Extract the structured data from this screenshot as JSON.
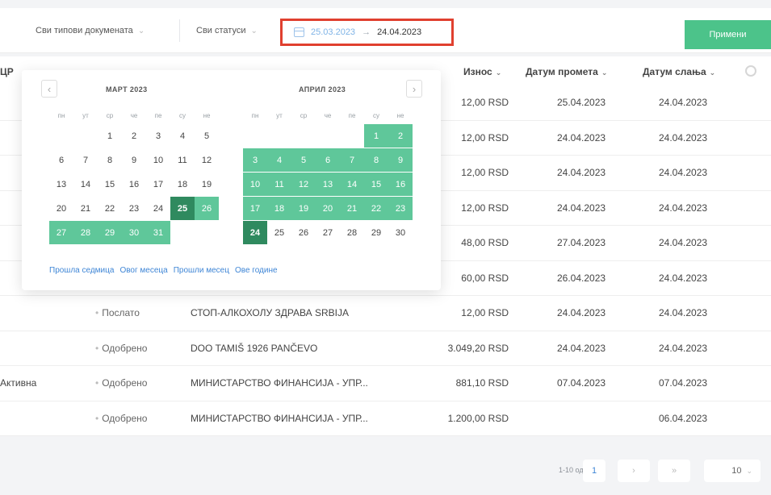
{
  "filters": {
    "doc_types": "Сви типови докумената",
    "statuses": "Сви статуси",
    "date_from": "25.03.2023",
    "date_arrow": "→",
    "date_to": "24.04.2023",
    "apply": "Примени"
  },
  "table": {
    "headers": {
      "col_cut": "ЦР",
      "amount": "Износ",
      "turnover_date": "Датум промета",
      "send_date": "Датум слања"
    },
    "rows": [
      {
        "state": "",
        "status": "",
        "partner": "",
        "amount": "12,00 RSD",
        "turnover": "25.04.2023",
        "sent": "24.04.2023"
      },
      {
        "state": "",
        "status": "",
        "partner": "",
        "amount": "12,00 RSD",
        "turnover": "24.04.2023",
        "sent": "24.04.2023"
      },
      {
        "state": "",
        "status": "",
        "partner": "",
        "amount": "12,00 RSD",
        "turnover": "24.04.2023",
        "sent": "24.04.2023"
      },
      {
        "state": "",
        "status": "",
        "partner": "",
        "amount": "12,00 RSD",
        "turnover": "24.04.2023",
        "sent": "24.04.2023"
      },
      {
        "state": "",
        "status": "",
        "partner": "",
        "amount": "48,00 RSD",
        "turnover": "27.04.2023",
        "sent": "24.04.2023"
      },
      {
        "state": "",
        "status": "",
        "partner": "",
        "amount": "60,00 RSD",
        "turnover": "26.04.2023",
        "sent": "24.04.2023"
      },
      {
        "state": "",
        "status": "Послато",
        "partner": "СТОП-АЛКОХОЛУ ЗДРАВА SRBIJA",
        "amount": "12,00 RSD",
        "turnover": "24.04.2023",
        "sent": "24.04.2023"
      },
      {
        "state": "",
        "status": "Одобрено",
        "partner": "DOO TAMIŠ 1926 PANČEVO",
        "amount": "3.049,20 RSD",
        "turnover": "24.04.2023",
        "sent": "24.04.2023"
      },
      {
        "state": "Активна",
        "status": "Одобрено",
        "partner": "МИНИСТАРСТВО ФИНАНСИЈА - УПР...",
        "amount": "881,10 RSD",
        "turnover": "07.04.2023",
        "sent": "07.04.2023"
      },
      {
        "state": "",
        "status": "Одобрено",
        "partner": "МИНИСТАРСТВО ФИНАНСИЈА - УПР...",
        "amount": "1.200,00 RSD",
        "turnover": "",
        "sent": "06.04.2023"
      }
    ]
  },
  "calendar": {
    "prev": "‹",
    "next": "›",
    "weekdays": [
      "пн",
      "ут",
      "ср",
      "че",
      "пе",
      "су",
      "не"
    ],
    "months": [
      {
        "title": "МАРТ 2023",
        "weeks": [
          [
            null,
            null,
            1,
            2,
            3,
            4,
            5
          ],
          [
            6,
            7,
            8,
            9,
            10,
            11,
            12
          ],
          [
            13,
            14,
            15,
            16,
            17,
            18,
            19
          ],
          [
            20,
            21,
            22,
            23,
            24,
            25,
            26
          ],
          [
            27,
            28,
            29,
            30,
            31,
            null,
            null
          ]
        ],
        "range_start": 25,
        "range_end": 31,
        "edge": 25
      },
      {
        "title": "АПРИЛ 2023",
        "weeks": [
          [
            null,
            null,
            null,
            null,
            null,
            1,
            2
          ],
          [
            3,
            4,
            5,
            6,
            7,
            8,
            9
          ],
          [
            10,
            11,
            12,
            13,
            14,
            15,
            16
          ],
          [
            17,
            18,
            19,
            20,
            21,
            22,
            23
          ],
          [
            24,
            25,
            26,
            27,
            28,
            29,
            30
          ]
        ],
        "range_start": 1,
        "range_end": 24,
        "edge": 24
      }
    ],
    "shortcuts": [
      "Прошла седмица",
      "Овог месеца",
      "Прошли месец",
      "Ове године"
    ]
  },
  "pagination": {
    "info": "1-10 од 995",
    "page": "1",
    "next": "›",
    "last": "»",
    "page_size": "10"
  },
  "colors": {
    "accent_green": "#4cc38a",
    "range_green": "#5fc79a",
    "edge_green": "#2f8a5f",
    "highlight_red": "#e0402f",
    "link_blue": "#3f86d6"
  }
}
